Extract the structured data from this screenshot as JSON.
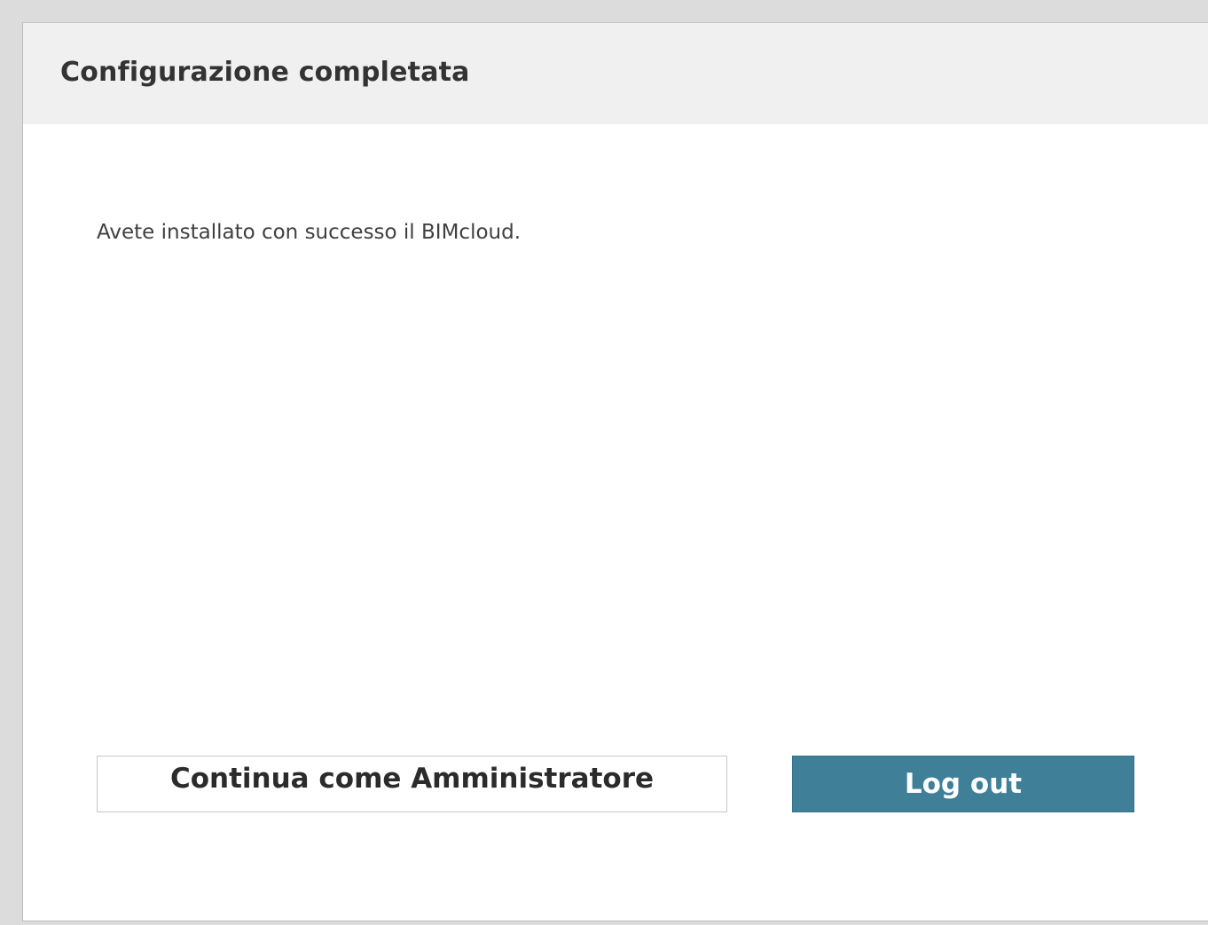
{
  "dialog": {
    "title": "Configurazione completata",
    "message": "Avete installato con successo il BIMcloud.",
    "buttons": {
      "continue_admin_label": "Continua come Amministratore",
      "logout_label": "Log out"
    }
  },
  "colors": {
    "page_background": "#dcdcdc",
    "header_background": "#f0f0f0",
    "primary_button": "#3f7f98",
    "text": "#333333"
  }
}
